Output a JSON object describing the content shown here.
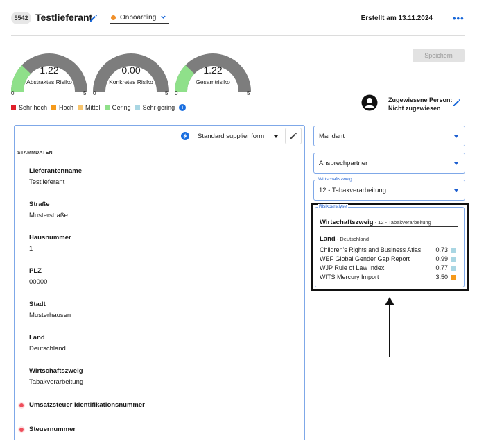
{
  "header": {
    "id": "5542",
    "title": "Testlieferant",
    "status": "Onboarding",
    "created": "Erstellt am 13.11.2024",
    "more": "•••"
  },
  "save_label": "Speichern",
  "gauges": [
    {
      "value": "1.22",
      "label": "Abstraktes Risiko",
      "min": "0",
      "max": "5",
      "fill": 0.244
    },
    {
      "value": "0.00",
      "label": "Konkretes Risiko",
      "min": "0",
      "max": "5",
      "fill": 0.0
    },
    {
      "value": "1.22",
      "label": "Gesamtrisiko",
      "min": "0",
      "max": "5",
      "fill": 0.244
    }
  ],
  "legend": [
    {
      "label": "Sehr hoch",
      "color": "#e0202a"
    },
    {
      "label": "Hoch",
      "color": "#f59a1b"
    },
    {
      "label": "Mittel",
      "color": "#f7c46c"
    },
    {
      "label": "Gering",
      "color": "#8fe08a"
    },
    {
      "label": "Sehr gering",
      "color": "#a9d6e3"
    }
  ],
  "assigned": {
    "label": "Zugewiesene Person:",
    "value": "Nicht zugewiesen"
  },
  "form": {
    "selected": "Standard supplier form",
    "section": "STAMMDATEN",
    "fields": [
      {
        "label": "Lieferantenname",
        "value": "Testlieferant"
      },
      {
        "label": "Straße",
        "value": "Musterstraße"
      },
      {
        "label": "Hausnummer",
        "value": "1"
      },
      {
        "label": "PLZ",
        "value": "00000"
      },
      {
        "label": "Stadt",
        "value": "Musterhausen"
      },
      {
        "label": "Land",
        "value": "Deutschland"
      },
      {
        "label": "Wirtschaftszweig",
        "value": "Tabakverarbeitung"
      }
    ],
    "required_fields": [
      {
        "label": "Umsatzsteuer Identifikationsnummer"
      },
      {
        "label": "Steuernummer"
      }
    ]
  },
  "right": {
    "mandant": "Mandant",
    "ansprechpartner": "Ansprechpartner",
    "wirtschaftszweig_label": "Wirtschaftszweig",
    "wirtschaftszweig_value": "12 - Tabakverarbeitung"
  },
  "risk": {
    "legend": "Risikoanalyse",
    "sector_label": "Wirtschaftszweig",
    "sector_value": " - 12 - Tabakverarbeitung",
    "country_label": "Land",
    "country_value": " - Deutschland",
    "rows": [
      {
        "name": "Children's Rights and Business Atlas",
        "value": "0.73",
        "color": "#a9d6e3"
      },
      {
        "name": "WEF Global Gender Gap Report",
        "value": "0.99",
        "color": "#a9d6e3"
      },
      {
        "name": "WJP Rule of Law Index",
        "value": "0.77",
        "color": "#a9d6e3"
      },
      {
        "name": "WITS Mercury Import",
        "value": "3.50",
        "color": "#f59a1b"
      }
    ]
  }
}
